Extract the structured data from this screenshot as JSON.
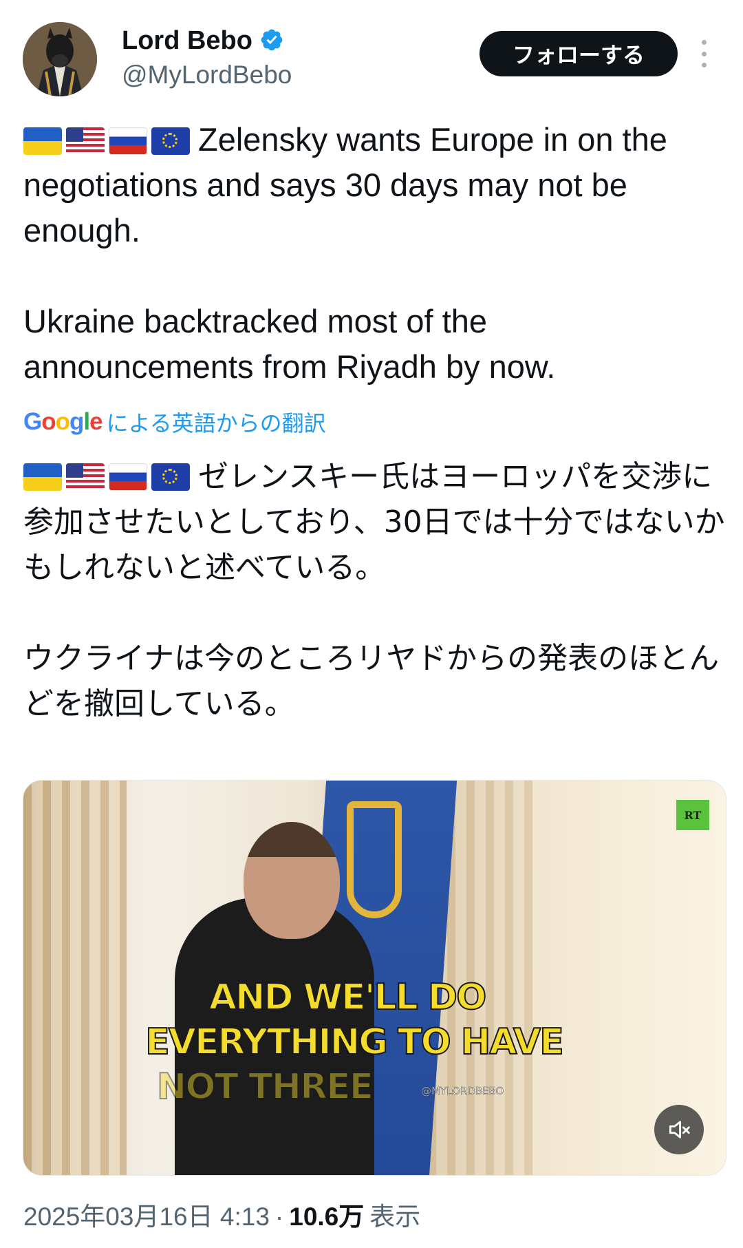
{
  "author": {
    "name": "Lord Bebo",
    "handle": "@MyLordBebo",
    "verified": true
  },
  "header": {
    "follow_label": "フォローする"
  },
  "tweet": {
    "flags": [
      "flag-ukraine-icon",
      "flag-usa-icon",
      "flag-russia-icon",
      "flag-eu-icon"
    ],
    "text": "Zelensky wants Europe in on the negotiations and says 30 days may not be enough.\n\nUkraine backtracked most of the announcements from Riyadh by now.",
    "translation_provider": "Google",
    "translation_link": "による英語からの翻訳",
    "translated_text": "ゼレンスキー氏はヨーロッパを交渉に参加させたいとしており、30日では十分ではないかもしれないと述べている。\n\nウクライナは今のところリヤドからの発表のほとんどを撤回している。"
  },
  "media": {
    "channel_logo": "RT",
    "subtitle_line1": "AND WE'LL DO",
    "subtitle_line2": "EVERYTHING TO HAVE",
    "subtitle_line3": "NOT THREE",
    "watermark": "@MYLORDBEBO",
    "muted": true
  },
  "meta": {
    "timestamp": "2025年03月16日 4:13",
    "separator": "·",
    "views_count": "10.6万",
    "views_label": "表示"
  },
  "colors": {
    "link": "#1d9bf0",
    "verified": "#1d9bf0",
    "text_secondary": "#536471",
    "button_bg": "#0f1419"
  }
}
